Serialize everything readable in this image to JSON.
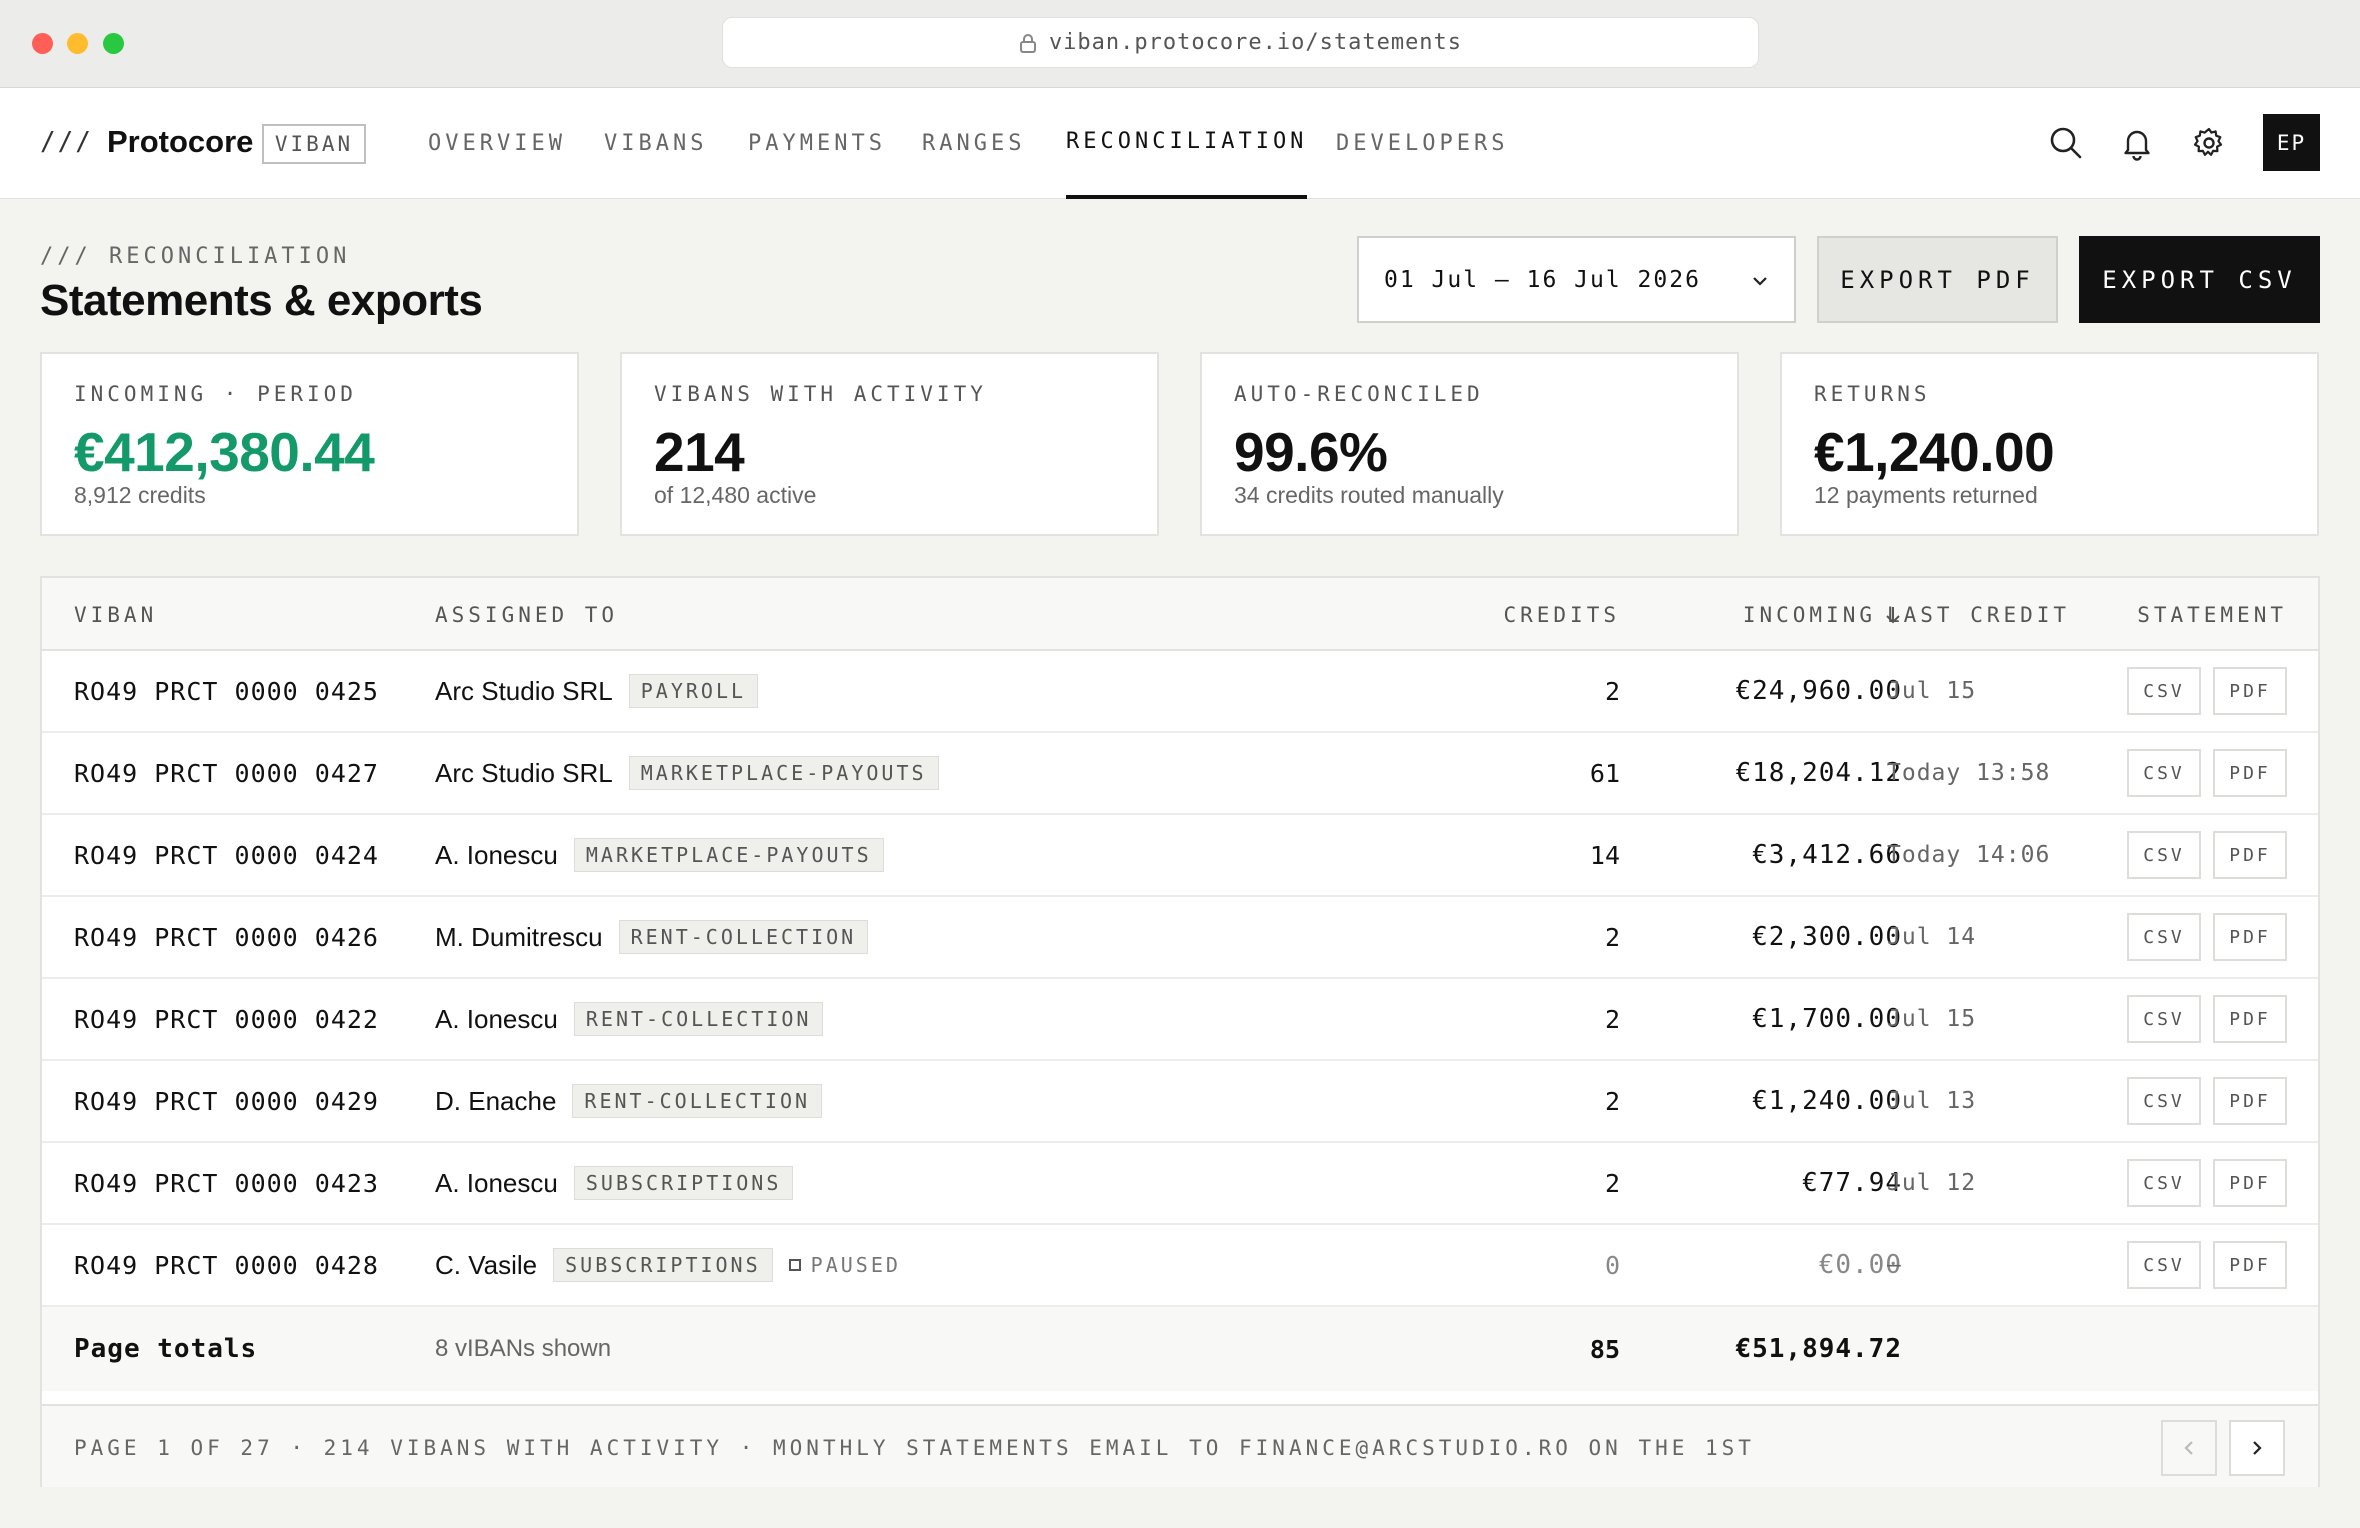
{
  "browser": {
    "url": "viban.protocore.io/statements"
  },
  "nav": {
    "logo_mark": "///",
    "brand": "Protocore",
    "product": "VIBAN",
    "links": [
      "OVERVIEW",
      "VIBANS",
      "PAYMENTS",
      "RANGES",
      "RECONCILIATION",
      "DEVELOPERS"
    ],
    "active": "RECONCILIATION",
    "avatar": "EP"
  },
  "header": {
    "eyebrow": "/// RECONCILIATION",
    "title": "Statements & exports",
    "date_range": "01 Jul – 16 Jul 2026",
    "export_pdf": "EXPORT PDF",
    "export_csv": "EXPORT CSV"
  },
  "stats": [
    {
      "label": "INCOMING · PERIOD",
      "value": "€412,380.44",
      "sub": "8,912 credits",
      "color": "#14996a"
    },
    {
      "label": "VIBANS WITH ACTIVITY",
      "value": "214",
      "sub": "of 12,480 active",
      "color": "#111111"
    },
    {
      "label": "AUTO-RECONCILED",
      "value": "99.6%",
      "sub": "34 credits routed manually",
      "color": "#111111"
    },
    {
      "label": "RETURNS",
      "value": "€1,240.00",
      "sub": "12 payments returned",
      "color": "#111111"
    }
  ],
  "table": {
    "headers": {
      "viban": "VIBAN",
      "assigned": "ASSIGNED TO",
      "credits": "CREDITS",
      "incoming": "INCOMING",
      "last_credit": "LAST CREDIT",
      "statement": "STATEMENT"
    },
    "rows": [
      {
        "viban": "RO49 PRCT 0000 0425",
        "name": "Arc Studio SRL",
        "tag": "PAYROLL",
        "status": "",
        "credits": "2",
        "incoming": "€24,960.00",
        "last": "Jul 15",
        "csv": "CSV",
        "pdf": "PDF"
      },
      {
        "viban": "RO49 PRCT 0000 0427",
        "name": "Arc Studio SRL",
        "tag": "MARKETPLACE-PAYOUTS",
        "status": "",
        "credits": "61",
        "incoming": "€18,204.12",
        "last": "Today 13:58",
        "csv": "CSV",
        "pdf": "PDF"
      },
      {
        "viban": "RO49 PRCT 0000 0424",
        "name": "A. Ionescu",
        "tag": "MARKETPLACE-PAYOUTS",
        "status": "",
        "credits": "14",
        "incoming": "€3,412.66",
        "last": "Today 14:06",
        "csv": "CSV",
        "pdf": "PDF"
      },
      {
        "viban": "RO49 PRCT 0000 0426",
        "name": "M. Dumitrescu",
        "tag": "RENT-COLLECTION",
        "status": "",
        "credits": "2",
        "incoming": "€2,300.00",
        "last": "Jul 14",
        "csv": "CSV",
        "pdf": "PDF"
      },
      {
        "viban": "RO49 PRCT 0000 0422",
        "name": "A. Ionescu",
        "tag": "RENT-COLLECTION",
        "status": "",
        "credits": "2",
        "incoming": "€1,700.00",
        "last": "Jul 15",
        "csv": "CSV",
        "pdf": "PDF"
      },
      {
        "viban": "RO49 PRCT 0000 0429",
        "name": "D. Enache",
        "tag": "RENT-COLLECTION",
        "status": "",
        "credits": "2",
        "incoming": "€1,240.00",
        "last": "Jul 13",
        "csv": "CSV",
        "pdf": "PDF"
      },
      {
        "viban": "RO49 PRCT 0000 0423",
        "name": "A. Ionescu",
        "tag": "SUBSCRIPTIONS",
        "status": "",
        "credits": "2",
        "incoming": "€77.94",
        "last": "Jul 12",
        "csv": "CSV",
        "pdf": "PDF"
      },
      {
        "viban": "RO49 PRCT 0000 0428",
        "name": "C. Vasile",
        "tag": "SUBSCRIPTIONS",
        "status": "PAUSED",
        "credits": "0",
        "incoming": "€0.00",
        "last": "–",
        "csv": "CSV",
        "pdf": "PDF"
      }
    ],
    "totals": {
      "label": "Page totals",
      "shown": "8 vIBANs shown",
      "credits": "85",
      "incoming": "€51,894.72"
    },
    "footer": "PAGE 1 OF 27 · 214 VIBANS WITH ACTIVITY · MONTHLY STATEMENTS EMAIL TO FINANCE@ARCSTUDIO.RO ON THE 1ST"
  }
}
